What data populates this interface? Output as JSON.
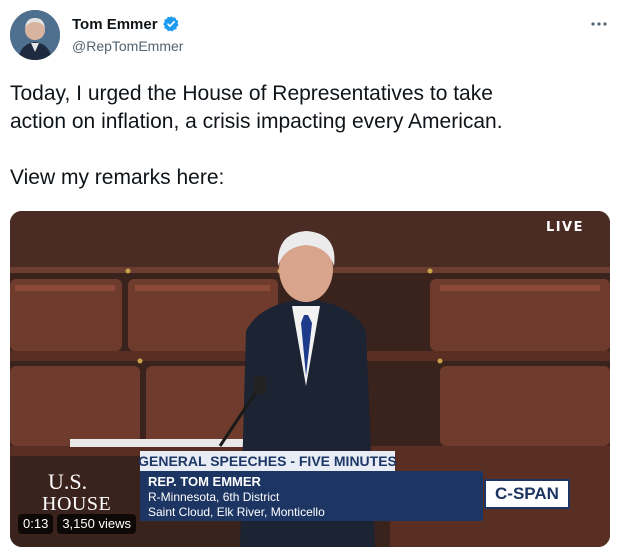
{
  "author": {
    "name": "Tom Emmer",
    "handle": "@RepTomEmmer",
    "verified": true,
    "more_icon": "more-horizontal-icon"
  },
  "tweet": {
    "line1": "Today, I urged the House of Representatives to take",
    "line2": "action on inflation, a crisis impacting every American.",
    "line3": "View my remarks here:"
  },
  "video": {
    "live_label": "LIVE",
    "banner_title": "GENERAL SPEECHES - FIVE MINUTES",
    "speaker_name": "REP. TOM EMMER",
    "speaker_district": "R-Minnesota, 6th District",
    "speaker_cities": "Saint Cloud, Elk River, Monticello",
    "logo_line1": "U.S.",
    "logo_line2": "HOUSE",
    "network": "C-SPAN",
    "elapsed": "0:13",
    "views": "3,150 views"
  },
  "colors": {
    "verified_blue": "#1d9bf0",
    "banner_navy": "#1d3562",
    "handle_gray": "#536471"
  }
}
